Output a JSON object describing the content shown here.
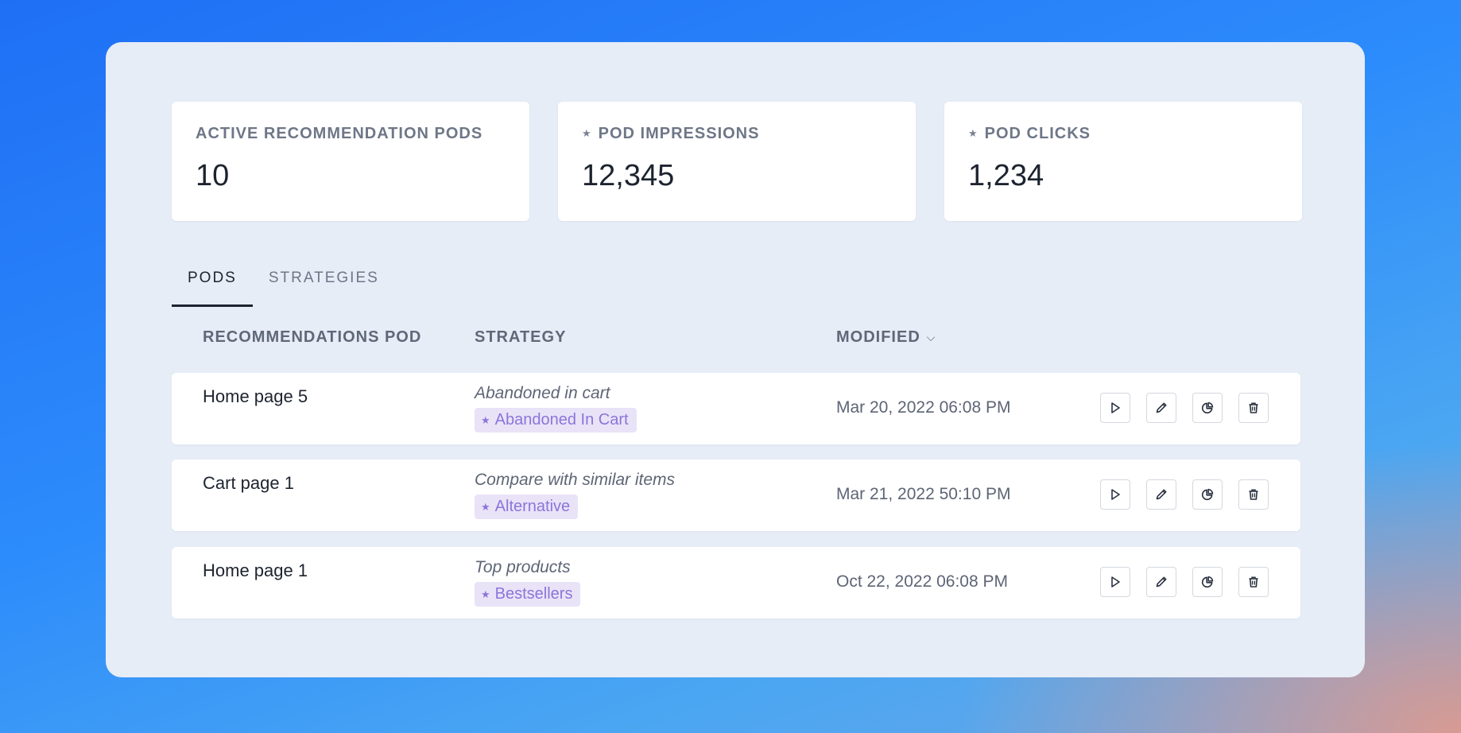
{
  "stats": [
    {
      "label": "ACTIVE RECOMMENDATION PODS",
      "value": "10",
      "has_star": false
    },
    {
      "label": "POD IMPRESSIONS",
      "value": "12,345",
      "has_star": true
    },
    {
      "label": "POD CLICKS",
      "value": "1,234",
      "has_star": true
    }
  ],
  "tabs": [
    {
      "label": "PODS",
      "active": true
    },
    {
      "label": "STRATEGIES",
      "active": false
    }
  ],
  "table": {
    "headers": {
      "pod": "RECOMMENDATIONS POD",
      "strategy": "STRATEGY",
      "modified": "MODIFIED"
    },
    "rows": [
      {
        "name": "Home page 5",
        "strategy_desc": "Abandoned in cart",
        "badge": "Abandoned In Cart",
        "modified": "Mar 20, 2022 06:08 PM"
      },
      {
        "name": "Cart page 1",
        "strategy_desc": "Compare with similar items",
        "badge": "Alternative",
        "modified": "Mar 21, 2022 50:10 PM"
      },
      {
        "name": "Home page 1",
        "strategy_desc": "Top products",
        "badge": "Bestsellers",
        "modified": "Oct 22, 2022 06:08 PM"
      }
    ]
  },
  "icons": {
    "star": "★",
    "chevron": "⌵",
    "actions": [
      "play-icon",
      "edit-icon",
      "stats-icon",
      "trash-icon"
    ]
  },
  "colors": {
    "badge_bg": "#e9e3f8",
    "badge_text": "#8a76d8",
    "panel_bg": "#e7edf7"
  }
}
